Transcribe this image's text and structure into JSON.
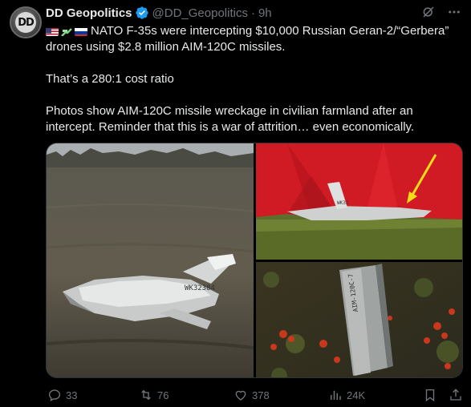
{
  "author": {
    "avatar_text": "DD",
    "name": "DD Geopolitics",
    "handle": "@DD_Geopolitics",
    "separator": "·",
    "time": "9h"
  },
  "top_icons": [
    "grok-icon",
    "more-icon"
  ],
  "tweet": {
    "flags": [
      "us-flag",
      "peace-icon",
      "russia-flag"
    ],
    "line1": "NATO F-35s were intercepting $10,000 Russian Geran-2/“Gerbera” drones using $2.8 million AIM-120C missiles.",
    "line2": "That’s a 280:1 cost ratio",
    "line3": "Photos show AIM-120C missile wreckage in civilian farmland after an intercept. Reminder that this is a war of attrition… even economically."
  },
  "media": {
    "drone_marking_1": "WK32384",
    "drone_marking_2": "WK32",
    "missile_marking": "AIM-120C-7"
  },
  "actions": {
    "replies": "33",
    "reposts": "76",
    "likes": "378",
    "views": "24K"
  },
  "colors": {
    "background": "#000000",
    "text": "#e7e9ea",
    "muted": "#71767b",
    "verified": "#1d9bf0",
    "tent_red": "#d11b24"
  }
}
